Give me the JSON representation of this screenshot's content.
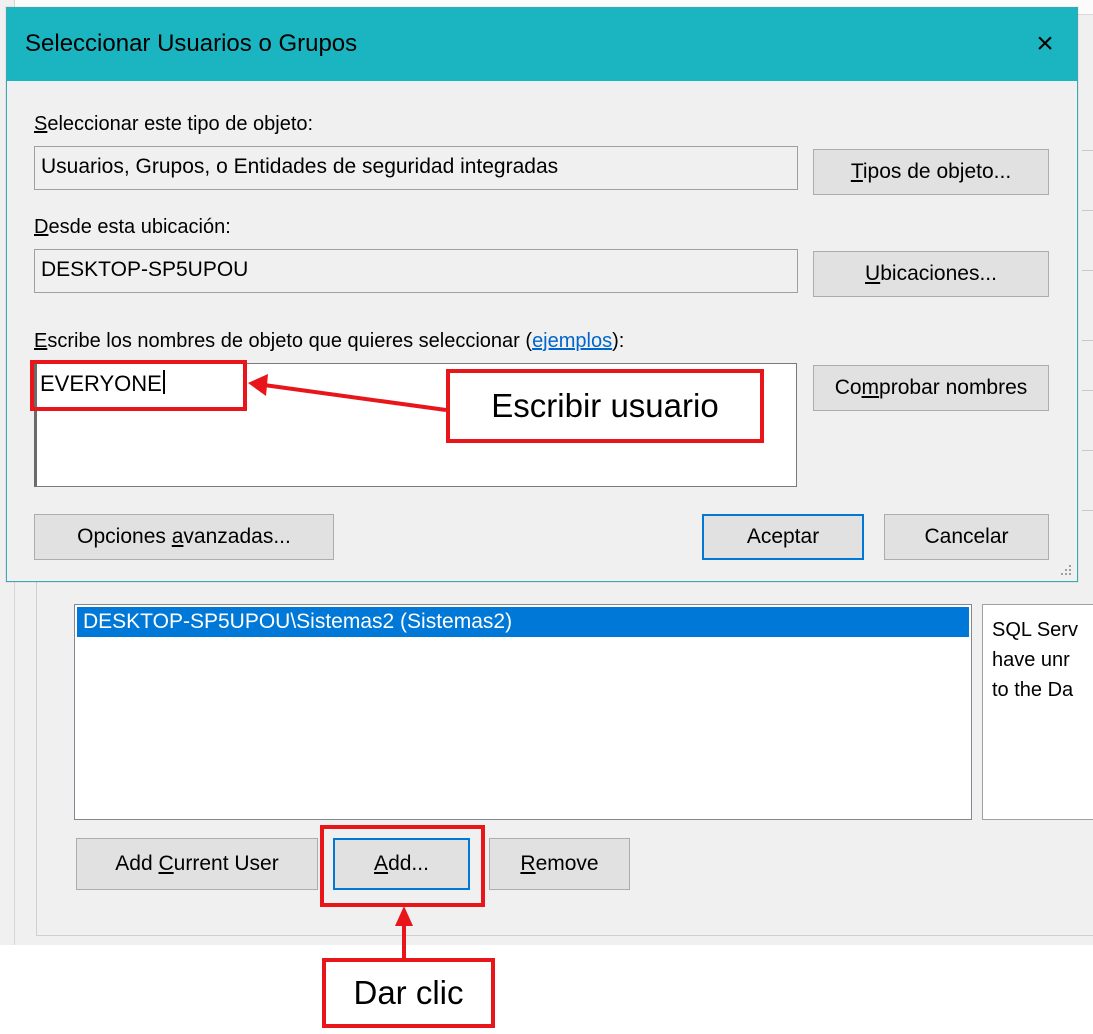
{
  "dialog": {
    "title": "Seleccionar Usuarios o Grupos",
    "object_type_label_first": "S",
    "object_type_label_rest": "eleccionar este tipo de objeto:",
    "object_type_value": "Usuarios, Grupos, o Entidades de seguridad integradas",
    "object_types_button_first": "T",
    "object_types_button_rest": "ipos de objeto...",
    "location_label_first": "D",
    "location_label_rest": "esde esta ubicación:",
    "location_value": "DESKTOP-SP5UPOU",
    "locations_button_first": "U",
    "locations_button_rest": "bicaciones...",
    "names_label_first": "E",
    "names_label_rest": "scribe los nombres de objeto que quieres seleccionar (",
    "names_label_link": "ejemplos",
    "names_label_end": "):",
    "names_value": "EVERYONE",
    "check_names_pre": "Co",
    "check_names_u": "m",
    "check_names_post": "probar nombres",
    "advanced_pre": "Opciones ",
    "advanced_u": "a",
    "advanced_post": "vanzadas...",
    "ok_label": "Aceptar",
    "cancel_label": "Cancelar"
  },
  "background": {
    "list_item": "DESKTOP-SP5UPOU\\Sistemas2 (Sistemas2)",
    "info_lines": [
      "SQL Serv",
      "have unr",
      "to the Da"
    ],
    "add_current_pre": "Add ",
    "add_current_u": "C",
    "add_current_post": "urrent User",
    "add_u": "A",
    "add_post": "dd...",
    "remove_u": "R",
    "remove_post": "emove"
  },
  "annotations": {
    "write_user": "Escribir usuario",
    "click": "Dar clic",
    "color": "#e8151b"
  },
  "icons": {
    "close": "×"
  },
  "colors": {
    "titlebar": "#1bb5c1",
    "selection": "#0078d7",
    "link": "#0066cc"
  }
}
